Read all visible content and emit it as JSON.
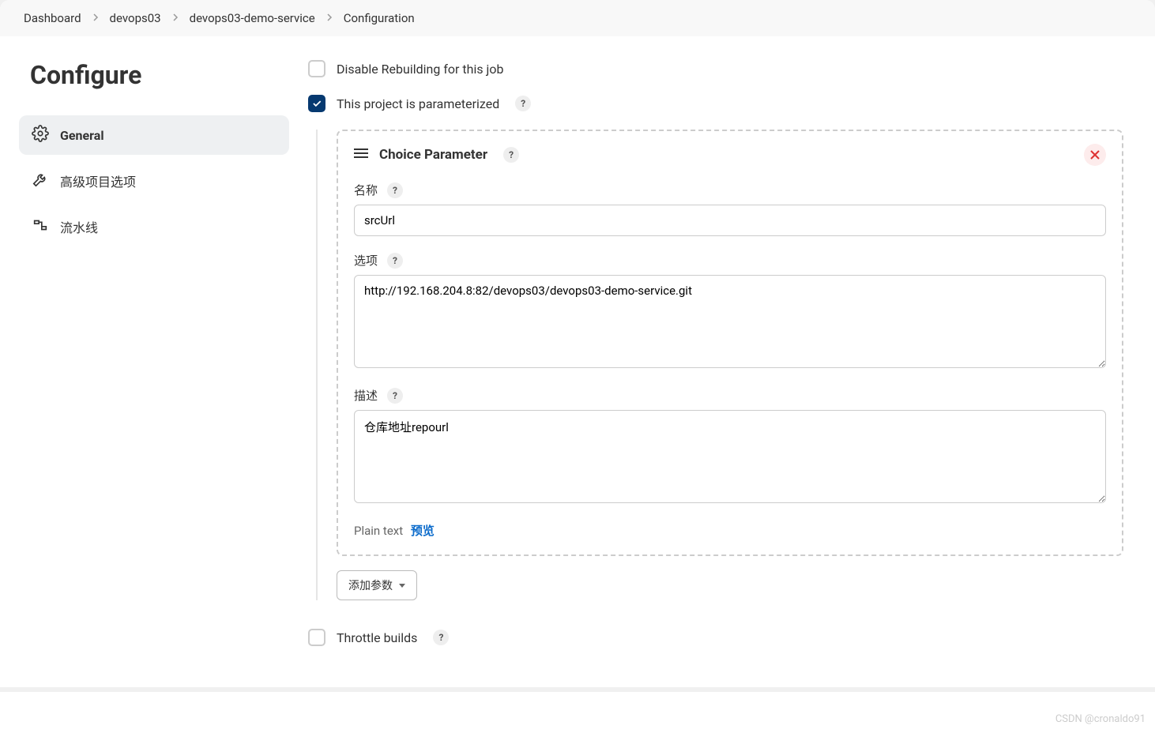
{
  "breadcrumb": {
    "items": [
      "Dashboard",
      "devops03",
      "devops03-demo-service",
      "Configuration"
    ]
  },
  "sidebar": {
    "title": "Configure",
    "nav": {
      "general": "General",
      "advanced": "高级项目选项",
      "pipeline": "流水线"
    }
  },
  "form": {
    "disable_rebuild": "Disable Rebuilding for this job",
    "parameterized": "This project is parameterized",
    "throttle": "Throttle builds",
    "add_param": "添加参数"
  },
  "param": {
    "type": "Choice Parameter",
    "name_label": "名称",
    "name_value": "srcUrl",
    "choices_label": "选项",
    "choices_value": "http://192.168.204.8:82/devops03/devops03-demo-service.git",
    "desc_label": "描述",
    "desc_value": "仓库地址repourl",
    "plain_text": "Plain text",
    "preview": "预览"
  },
  "watermark": "CSDN @cronaldo91"
}
